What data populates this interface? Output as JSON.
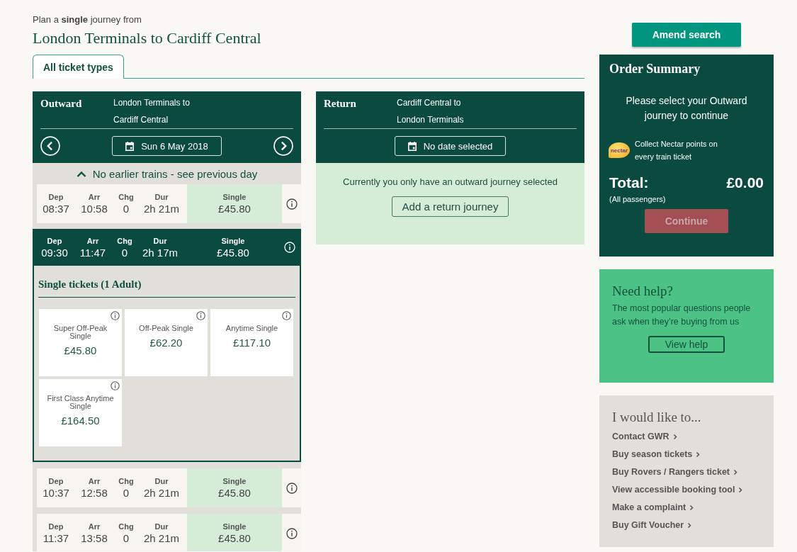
{
  "header": {
    "intro": "Plan a **single** journey from",
    "title": "London Terminals to Cardiff Central"
  },
  "tabs": [
    {
      "label": "All ticket types",
      "selected": true
    }
  ],
  "outward": {
    "heading": "Outward",
    "route": [
      "London Terminals to",
      "Cardiff Central"
    ],
    "date": "Sun 6 May 2018",
    "earlier": "No earlier trains - see previous day",
    "trains": [
      {
        "labels": [
          "Dep",
          "Arr",
          "Chg",
          "Dur",
          "Single"
        ],
        "dep": "08:37",
        "arr": "10:58",
        "chg": "0",
        "dur": "2h 21m",
        "fare": "£45.80",
        "selected": false
      },
      {
        "labels": [
          "Dep",
          "Arr",
          "Chg",
          "Dur",
          "Single"
        ],
        "dep": "09:30",
        "arr": "11:47",
        "chg": "0",
        "dur": "2h 17m",
        "fare": "£45.80",
        "selected": true,
        "tickets": {
          "heading": "Single tickets (1 Adult)",
          "items": [
            {
              "name": "Super Off-Peak Single",
              "price": "£45.80"
            },
            {
              "name": "Off-Peak Single",
              "price": "£62.20"
            },
            {
              "name": "Anytime Single",
              "price": "£117.10"
            },
            {
              "name": "First Class Anytime Single",
              "price": "£164.50"
            }
          ]
        }
      },
      {
        "labels": [
          "Dep",
          "Arr",
          "Chg",
          "Dur",
          "Single"
        ],
        "dep": "10:37",
        "arr": "12:58",
        "chg": "0",
        "dur": "2h 21m",
        "fare": "£45.80",
        "selected": false
      },
      {
        "labels": [
          "Dep",
          "Arr",
          "Chg",
          "Dur",
          "Single"
        ],
        "dep": "11:37",
        "arr": "13:58",
        "chg": "0",
        "dur": "2h 21m",
        "fare": "£45.80",
        "selected": false
      }
    ]
  },
  "return": {
    "heading": "Return",
    "route": [
      "Cardiff Central to",
      "London Terminals"
    ],
    "date": "No date selected",
    "message": "Currently you only have an outward journey selected",
    "button": "Add a return journey"
  },
  "amend_button": "Amend search",
  "order": {
    "title": "Order Summary",
    "message": "Please select your Outward journey to continue",
    "nectar_logo": "nectar",
    "nectar_text": "Collect Nectar points on every train ticket",
    "total_label": "Total:",
    "total": "£0.00",
    "note": "(All passengers)",
    "continue": {
      "label": "Continue",
      "disabled": true
    }
  },
  "help": {
    "title": "Need help?",
    "text": "The most popular questions people ask when they’re buying from us",
    "button": "View help"
  },
  "links": {
    "title": "I would like to...",
    "items": [
      "Contact GWR",
      "Buy season tickets",
      "Buy Rovers / Rangers ticket",
      "View accessible booking tool",
      "Make a complaint",
      "Buy Gift Voucher"
    ]
  }
}
